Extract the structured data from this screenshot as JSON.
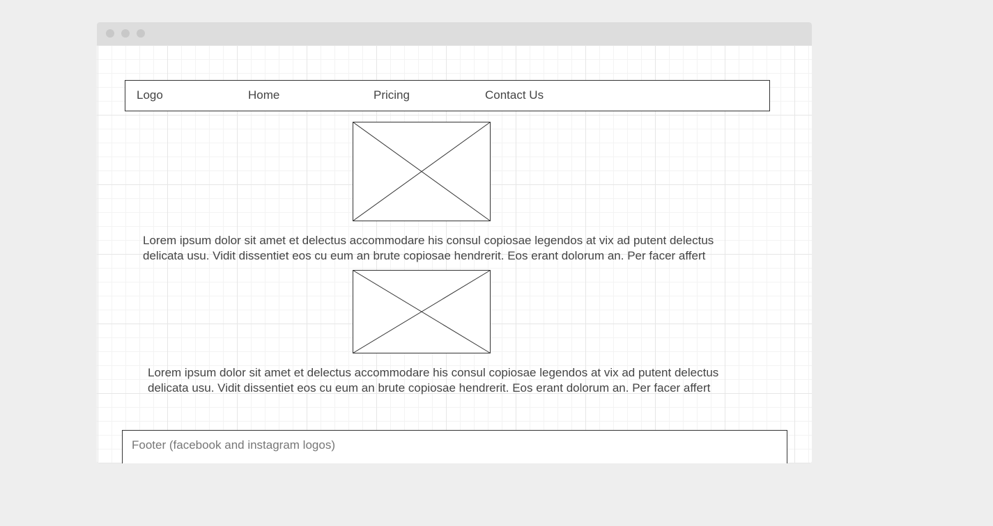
{
  "navbar": {
    "items": [
      {
        "label": "Logo"
      },
      {
        "label": "Home"
      },
      {
        "label": "Pricing"
      },
      {
        "label": "Contact Us"
      }
    ]
  },
  "content": {
    "paragraphs": [
      {
        "line1": "Lorem ipsum dolor sit amet et delectus accommodare his consul copiosae legendos at vix ad putent delectus",
        "line2": "delicata usu. Vidit dissentiet eos cu eum an brute copiosae hendrerit. Eos erant dolorum an. Per facer affert"
      },
      {
        "line1": "Lorem ipsum dolor sit amet et delectus accommodare his consul copiosae legendos at vix ad putent delectus",
        "line2": "delicata usu. Vidit dissentiet eos cu eum an brute copiosae hendrerit. Eos erant dolorum an. Per facer affert"
      }
    ]
  },
  "footer": {
    "text": "Footer (facebook and instagram logos)"
  }
}
